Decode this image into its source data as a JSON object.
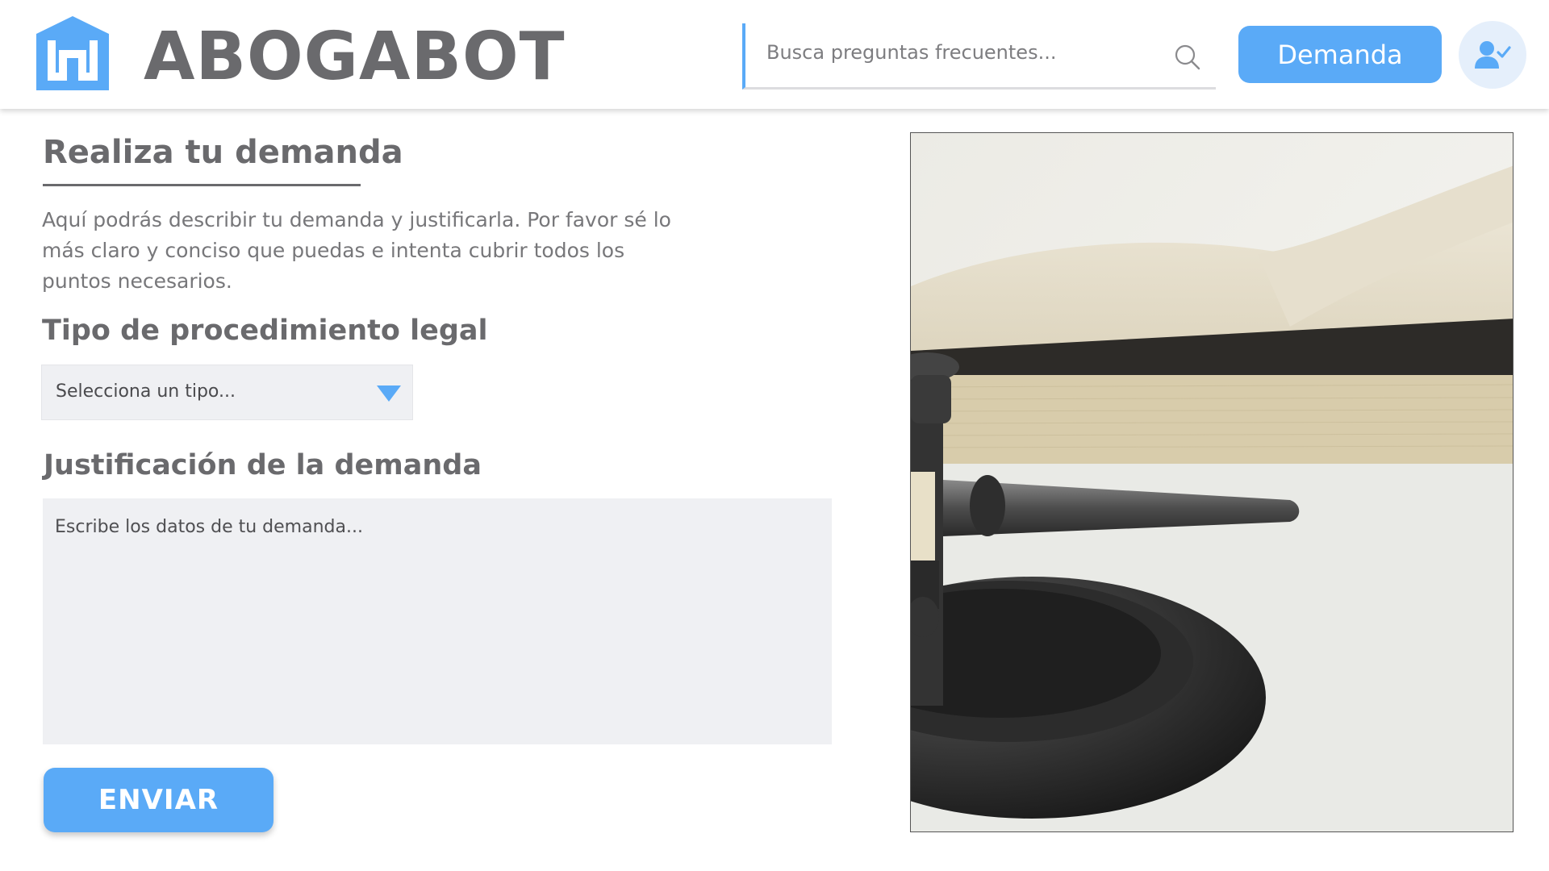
{
  "header": {
    "brand": "ABOGABOT",
    "search_placeholder": "Busca preguntas frecuentes...",
    "demanda_label": "Demanda"
  },
  "form": {
    "title": "Realiza tu demanda",
    "intro": "Aquí podrás describir tu demanda y justificarla. Por favor sé lo más claro y conciso que puedas e intenta cubrir todos los puntos necesarios.",
    "tipo_label": "Tipo de procedimiento legal",
    "tipo_placeholder": "Selecciona un tipo...",
    "justificacion_label": "Justificación de la demanda",
    "justificacion_placeholder": "Escribe los datos de tu demanda...",
    "submit_label": "ENVIAR"
  },
  "colors": {
    "accent": "#5aaaf7",
    "text": "#6a6a6d",
    "field_bg": "#eff0f3"
  },
  "icons": {
    "logo": "abogabot-logo-icon",
    "search": "search-icon",
    "user": "user-check-icon",
    "dropdown": "caret-down-icon"
  }
}
